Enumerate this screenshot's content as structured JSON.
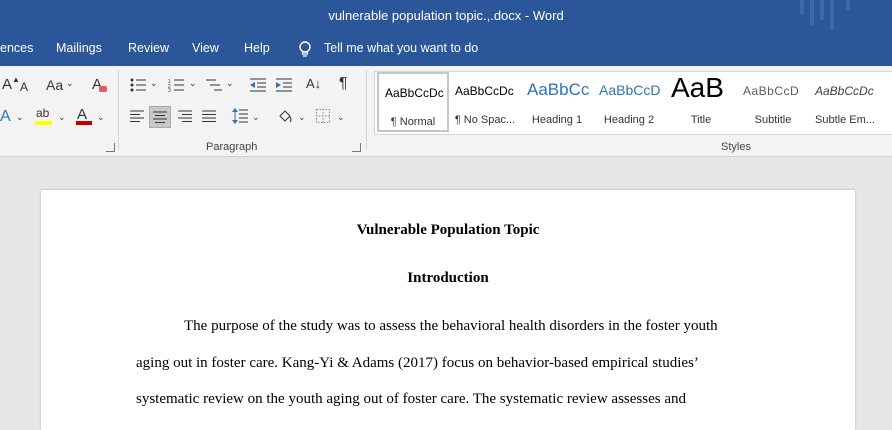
{
  "window": {
    "title": "vulnerable population topic.,.docx  -  Word"
  },
  "menu": {
    "items": [
      "ences",
      "Mailings",
      "Review",
      "View",
      "Help"
    ],
    "tell_me": "Tell me what you want to do"
  },
  "ribbon": {
    "groups": {
      "paragraph": "Paragraph",
      "styles": "Styles"
    },
    "styles": [
      {
        "sample": "AaBbCcDc",
        "name": "¶ Normal"
      },
      {
        "sample": "AaBbCcDc",
        "name": "¶ No Spac..."
      },
      {
        "sample": "AaBbCc",
        "name": "Heading 1"
      },
      {
        "sample": "AaBbCcD",
        "name": "Heading 2"
      },
      {
        "sample": "AaB",
        "name": "Title"
      },
      {
        "sample": "AaBbCcD",
        "name": "Subtitle"
      },
      {
        "sample": "AaBbCcDc",
        "name": "Subtle Em..."
      }
    ],
    "glyphs": {
      "font_size_up": "A",
      "font_size_down": "A",
      "change_case": "Aa",
      "clear_format": "A",
      "text_effect": "A",
      "highlight": "ab",
      "font_color": "A",
      "pilcrow": "¶",
      "sort": "A↓"
    }
  },
  "document": {
    "heading": "Vulnerable Population Topic",
    "section": "Introduction",
    "lines": [
      "The purpose of the study was to assess the behavioral health disorders in the foster youth",
      "aging out in foster care. Kang-Yi & Adams (2017) focus on behavior-based empirical studies’",
      "systematic review on the youth aging out of foster care. The systematic review assesses and"
    ]
  },
  "colors": {
    "title_bar": "#2b579a",
    "ribbon_bg": "#f3f3f3",
    "canvas_bg": "#e6e6e6",
    "font_color_bar": "#c00000",
    "highlight_bar": "#ffff00",
    "heading_blue": "#2e74b5"
  }
}
